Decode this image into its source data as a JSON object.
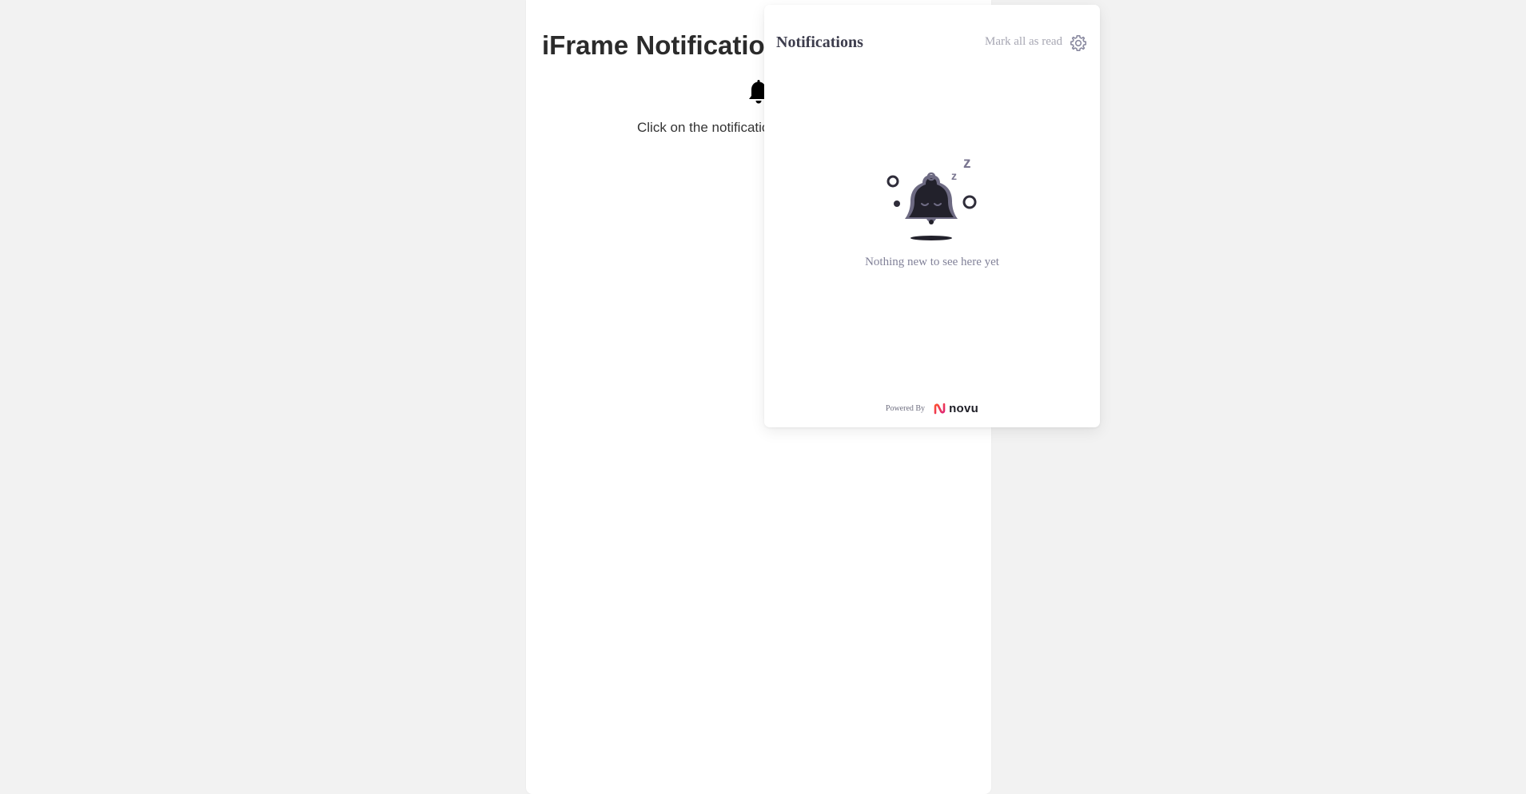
{
  "page": {
    "title": "iFrame Notification",
    "instructions": "Click on the notification"
  },
  "popover": {
    "title": "Notifications",
    "mark_all_label": "Mark all as read",
    "empty_message": "Nothing new to see here yet",
    "footer": {
      "powered_by": "Powered By",
      "brand": "novu"
    }
  },
  "icons": {
    "trigger": "bell-icon",
    "settings": "gear-icon",
    "empty_state": "sleeping-bell-icon",
    "brand": "novu-logo-icon"
  },
  "colors": {
    "background": "#f2f2f2",
    "panel": "#ffffff",
    "title_text": "#2b2b2b",
    "muted_text": "#a7a7b3",
    "brand_gradient_start": "#ff512f",
    "brand_gradient_end": "#dd2476"
  }
}
